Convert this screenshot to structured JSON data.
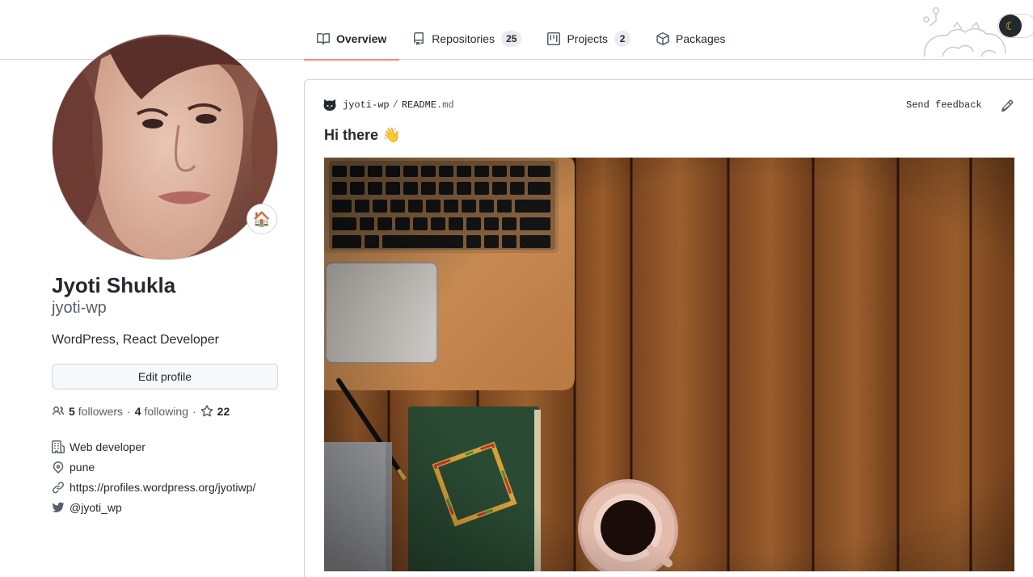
{
  "tabs": [
    {
      "label": "Overview",
      "icon": "book-icon",
      "active": true
    },
    {
      "label": "Repositories",
      "icon": "repo-icon",
      "count": "25"
    },
    {
      "label": "Projects",
      "icon": "project-icon",
      "count": "2"
    },
    {
      "label": "Packages",
      "icon": "package-icon"
    }
  ],
  "profile": {
    "name": "Jyoti Shukla",
    "login": "jyoti-wp",
    "bio": "WordPress, React Developer",
    "status_emoji": "🏠",
    "edit_label": "Edit profile",
    "followers_count": "5",
    "followers_label": "followers",
    "following_count": "4",
    "following_label": "following",
    "stars_count": "22",
    "separator": "·",
    "company": "Web developer",
    "location": "pune",
    "website": "https://profiles.wordpress.org/jyotiwp/",
    "twitter": "@jyoti_wp"
  },
  "readme": {
    "owner": "jyoti-wp",
    "slash": "/",
    "file": "README",
    "ext": ".md",
    "feedback": "Send feedback",
    "heading": "Hi there 👋"
  },
  "theme": {
    "accent": "#fd8c73",
    "dark_mode_icon": "moon-icon"
  }
}
